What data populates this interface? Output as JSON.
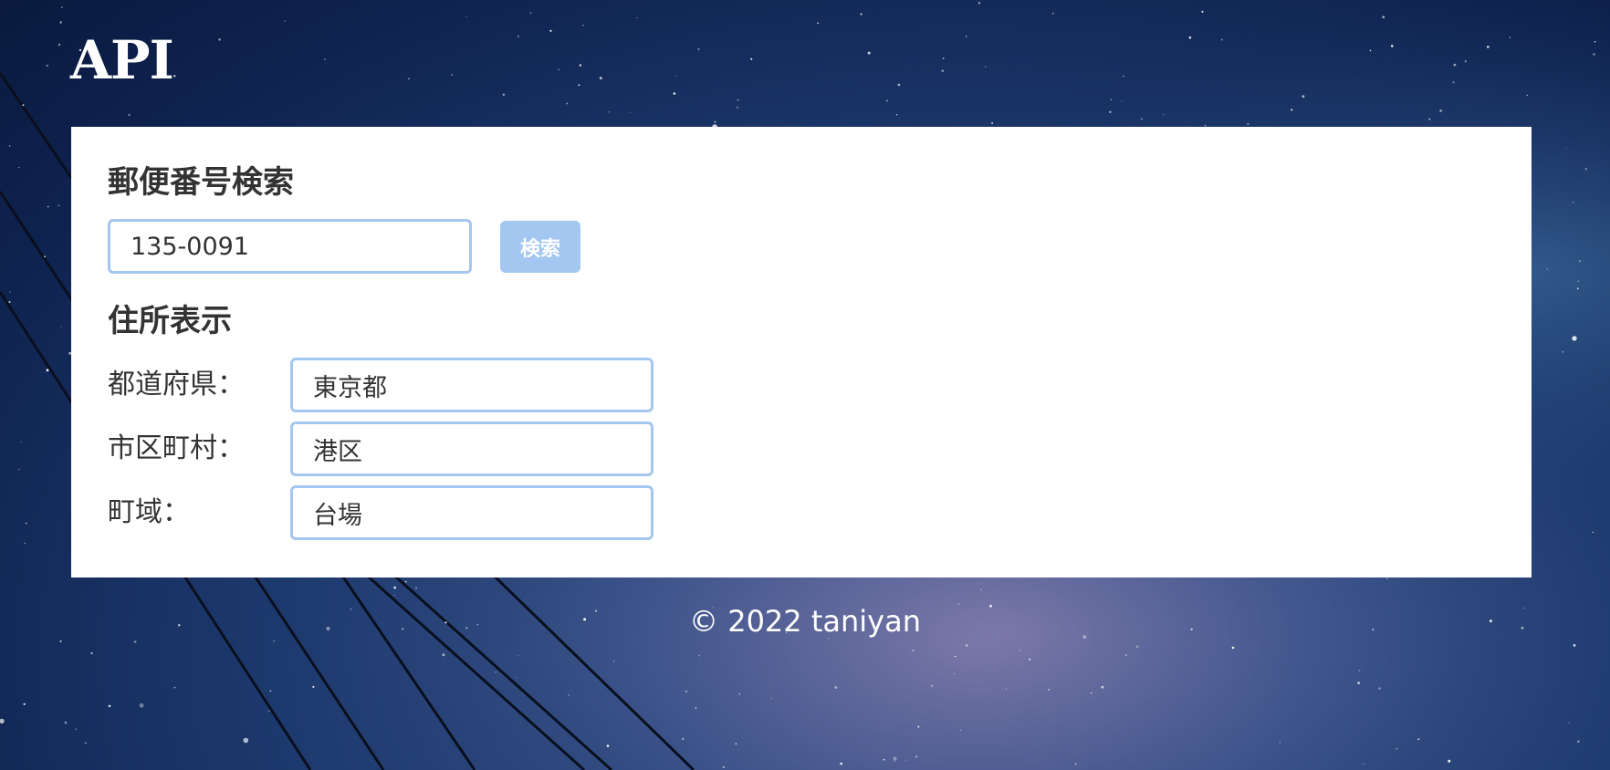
{
  "header": {
    "logo_text": "API"
  },
  "search": {
    "title": "郵便番号検索",
    "zipcode_value": "135-0091",
    "button_label": "検索"
  },
  "address": {
    "title": "住所表示",
    "fields": [
      {
        "label": "都道府県：",
        "value": "東京都"
      },
      {
        "label": "市区町村：",
        "value": "港区"
      },
      {
        "label": "町域：",
        "value": "台場"
      }
    ]
  },
  "footer": {
    "text": "© 2022 taniyan"
  },
  "colors": {
    "accent": "#a3c7f0",
    "text": "#333333",
    "card_background": "#ffffff",
    "sky_dark": "#0f2350",
    "sky_light": "#5a5f8e"
  }
}
